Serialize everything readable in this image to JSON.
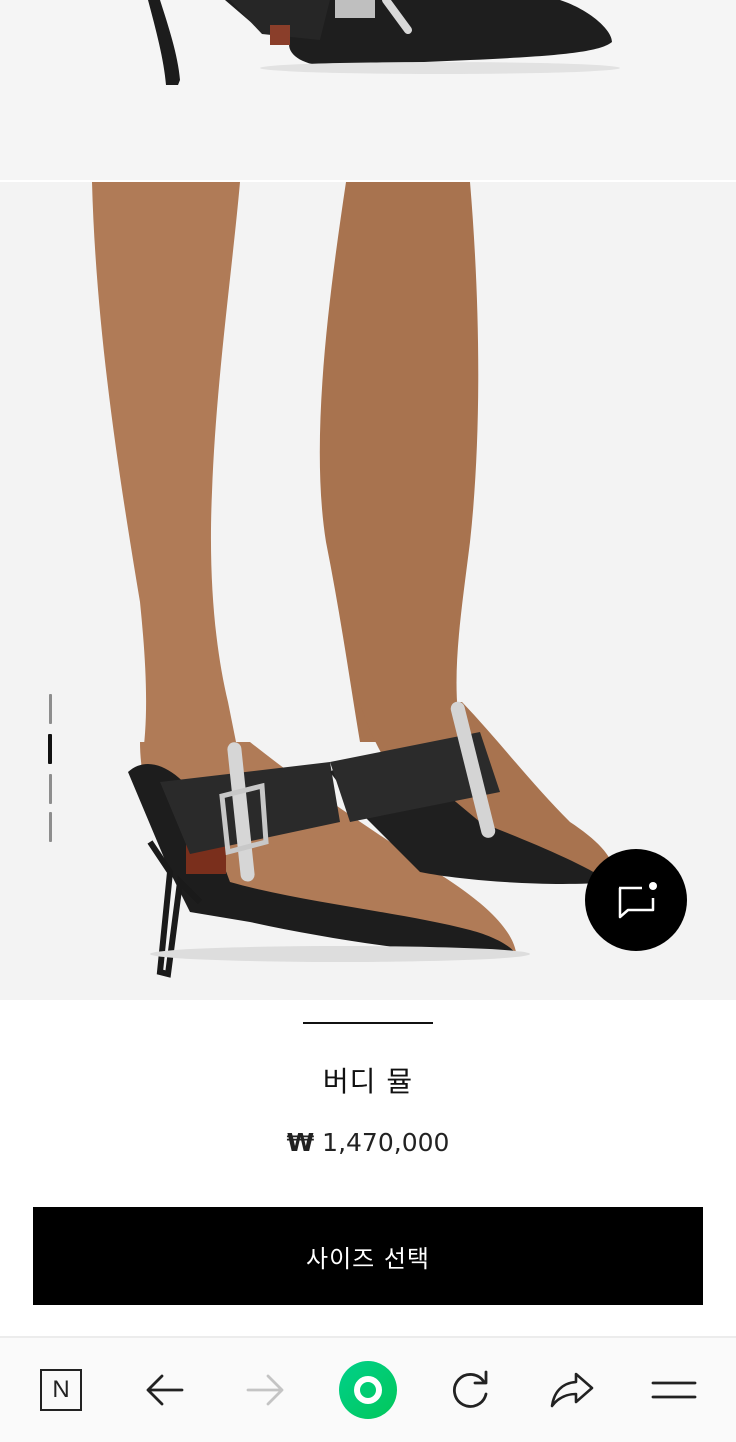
{
  "product": {
    "name": "버디 뮬",
    "currency_symbol": "₩",
    "price": "1,470,000"
  },
  "actions": {
    "size_select_label": "사이즈 선택"
  },
  "gallery": {
    "image_count": 4,
    "active_index": 2
  },
  "browser_toolbar": {
    "home_label": "N",
    "accent_color": "#03c75a",
    "items": [
      "naver-home-icon",
      "back-arrow-icon",
      "forward-arrow-icon",
      "green-search-icon",
      "refresh-icon",
      "share-icon",
      "menu-icon"
    ]
  },
  "colors": {
    "primary_button": "#000000",
    "background_photo": "#f3f3f3"
  }
}
